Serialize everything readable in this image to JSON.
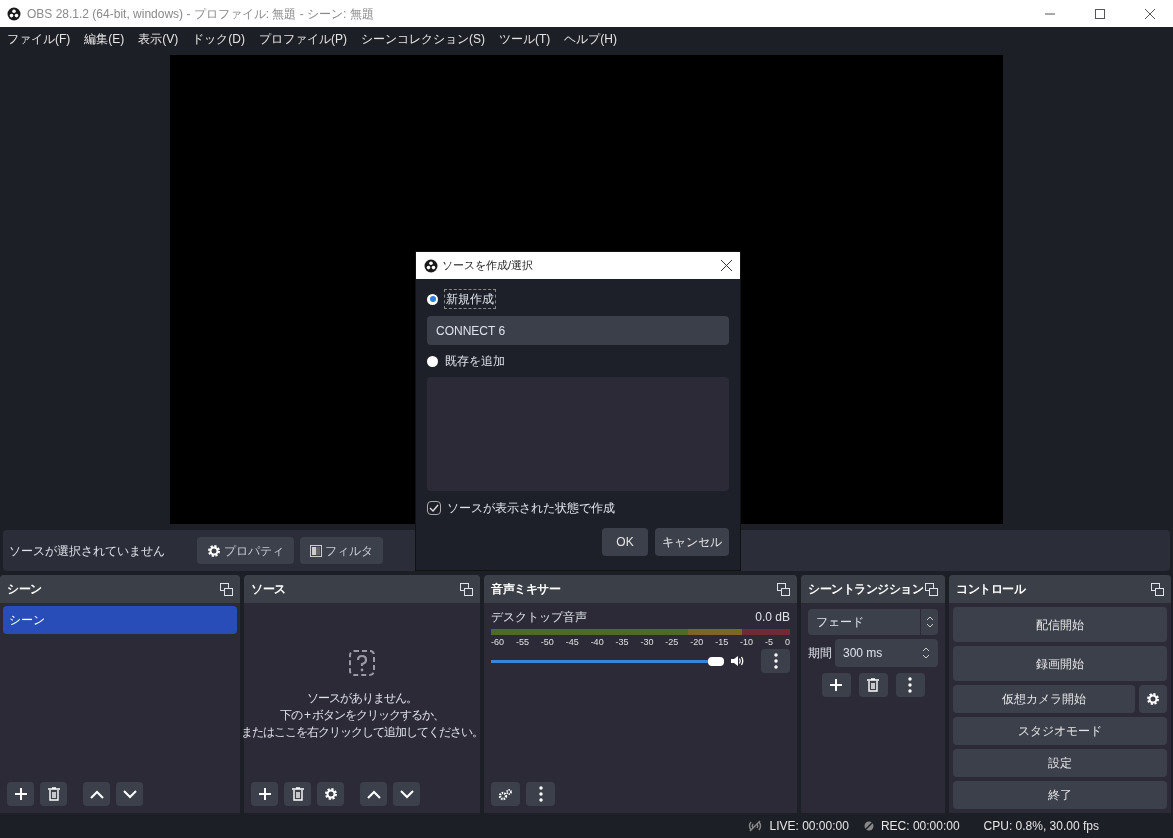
{
  "window": {
    "title": "OBS 28.1.2 (64-bit, windows) - プロファイル: 無題 - シーン: 無題"
  },
  "menu": [
    "ファイル(F)",
    "編集(E)",
    "表示(V)",
    "ドック(D)",
    "プロファイル(P)",
    "シーンコレクション(S)",
    "ツール(T)",
    "ヘルプ(H)"
  ],
  "context_bar": {
    "label": "ソースが選択されていません",
    "buttons": [
      {
        "kind": "properties",
        "label": "プロパティ"
      },
      {
        "kind": "filters",
        "label": "フィルタ"
      }
    ]
  },
  "scenes": {
    "title": "シーン",
    "items": [
      {
        "label": "シーン",
        "selected": true
      }
    ]
  },
  "sources": {
    "title": "ソース",
    "empty_lines": [
      "ソースがありません。",
      "下の + ボタンをクリックするか、",
      "またはここを右クリックして追加してください。"
    ]
  },
  "mixer": {
    "title": "音声ミキサー",
    "channels": [
      {
        "name": "デスクトップ音声",
        "reading": "0.0 dB",
        "level": 1,
        "ticks": [
          "-60",
          "-55",
          "-50",
          "-45",
          "-40",
          "-35",
          "-30",
          "-25",
          "-20",
          "-15",
          "-10",
          "-5",
          "0"
        ]
      }
    ]
  },
  "transitions": {
    "title": "シーントランジション",
    "transition": "フェード",
    "duration_label": "期間",
    "duration": "300 ms"
  },
  "controls": {
    "title": "コントロール",
    "buttons": [
      "配信開始",
      "録画開始",
      "仮想カメラ開始",
      "スタジオモード",
      "設定",
      "終了"
    ]
  },
  "status_bar": {
    "live": "LIVE: 00:00:00",
    "rec": "REC: 00:00:00",
    "cpu": "CPU: 0.8%, 30.00 fps"
  },
  "dialog": {
    "title": "ソースを作成/選択",
    "options": [
      {
        "label": "新規作成",
        "selected": true
      },
      {
        "label": "既存を追加",
        "selected": false
      }
    ],
    "name_value": "CONNECT 6",
    "visible_checkbox": {
      "label": "ソースが表示された状態で作成",
      "checked": true
    },
    "buttons": [
      "OK",
      "キャンセル"
    ]
  }
}
